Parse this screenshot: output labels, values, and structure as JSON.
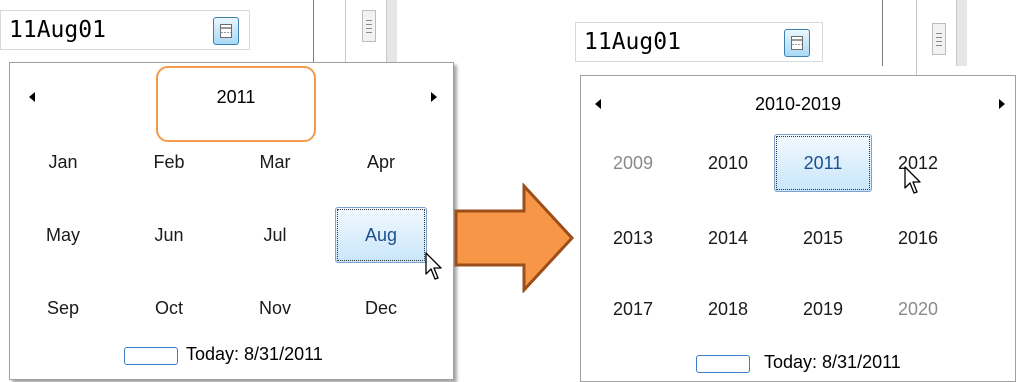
{
  "left": {
    "input_value": "11Aug01",
    "header": "2011",
    "months": [
      "Jan",
      "Feb",
      "Mar",
      "Apr",
      "May",
      "Jun",
      "Jul",
      "Aug",
      "Sep",
      "Oct",
      "Nov",
      "Dec"
    ],
    "selected": "Aug",
    "today_label": "Today: 8/31/2011"
  },
  "right": {
    "input_value": "11Aug01",
    "header": "2010-2019",
    "years": [
      "2009",
      "2010",
      "2011",
      "2012",
      "2013",
      "2014",
      "2015",
      "2016",
      "2017",
      "2018",
      "2019",
      "2020"
    ],
    "dim_years": [
      "2009",
      "2020"
    ],
    "selected": "2011",
    "today_label": "Today: 8/31/2011"
  },
  "icons": {
    "calendar": "calendar-icon",
    "prev": "left-arrow-icon",
    "next": "right-arrow-icon",
    "cursor": "mouse-cursor-icon",
    "transition": "orange-right-arrow-icon"
  },
  "colors": {
    "highlight": "#f39a4d",
    "arrow_fill": "#f79646",
    "arrow_stroke": "#9c4e1a",
    "selection_border": "#7da2ce",
    "today_border": "#3d7cc9"
  }
}
